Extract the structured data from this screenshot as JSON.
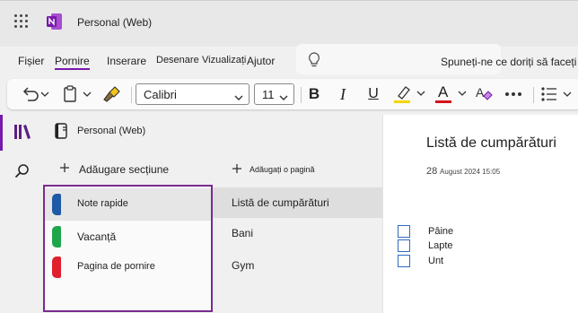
{
  "app": {
    "title": "Personal (Web)"
  },
  "menu": {
    "items": [
      "Fișier",
      "Pornire",
      "Inserare",
      "Desenare",
      "Vizualizați",
      "Ajutor"
    ],
    "active_index": 1,
    "tell_me": "Spuneți-ne ce doriți să faceți"
  },
  "toolbar": {
    "font_name": "Calibri",
    "font_size": "11",
    "bold": "B",
    "italic": "I",
    "underline": "U",
    "font_color_letter": "A",
    "highlight_color": "#f2d600",
    "font_color": "#d3121c",
    "icons": [
      "undo-icon",
      "paste-icon",
      "format-painter-icon",
      "highlighter-icon",
      "font-color-icon",
      "clear-formatting-icon",
      "more-icon",
      "bullets-icon"
    ]
  },
  "notebook": {
    "title": "Personal (Web)"
  },
  "sections": {
    "add_label": "Adăugare secțiune",
    "items": [
      {
        "label": "Note rapide",
        "color": "#1f5aa6"
      },
      {
        "label": "Vacanță",
        "color": "#1fa64a"
      },
      {
        "label": "Pagina de pornire",
        "color": "#e0202e"
      }
    ],
    "selected_index": 0
  },
  "pages": {
    "add_label": "Adăugați o pagină",
    "items": [
      "Listă de cumpărături",
      "Bani",
      "Gym"
    ],
    "selected_index": 0
  },
  "canvas": {
    "title": "Listă de cumpărături",
    "date_day": "28",
    "date_rest": "August 2024 15:05",
    "todos": [
      "Pâine",
      "Lapte",
      "Unt"
    ]
  },
  "colors": {
    "accent": "#7719aa",
    "checkbox": "#2f6bbd"
  }
}
